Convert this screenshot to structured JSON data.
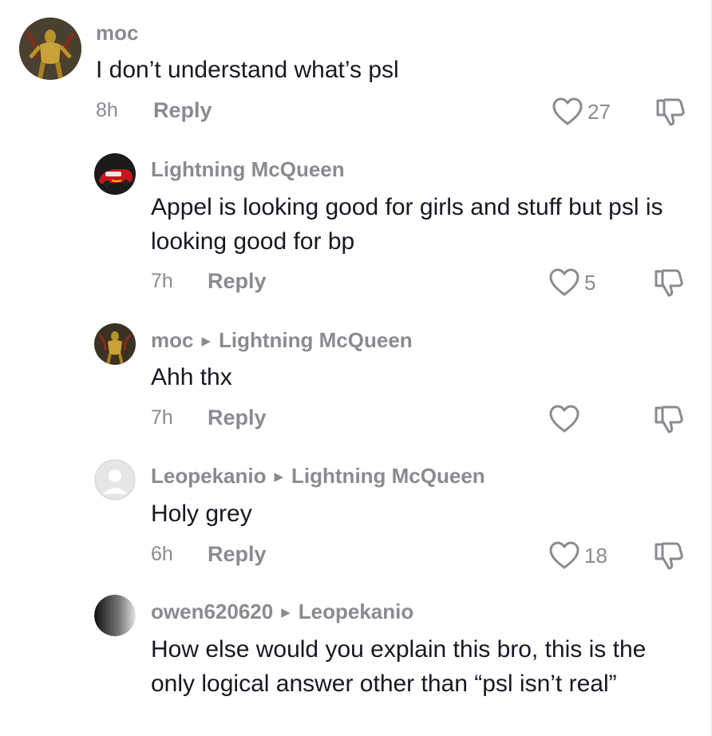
{
  "comments": [
    {
      "username": "moc",
      "reply_to": "",
      "text": "I don’t understand what’s psl",
      "time": "8h",
      "reply_label": "Reply",
      "likes": "27",
      "avatar": "warrior-avatar"
    },
    {
      "username": "Lightning McQueen",
      "reply_to": "",
      "text": "Appel is looking good for girls and stuff but psl is looking good for bp",
      "time": "7h",
      "reply_label": "Reply",
      "likes": "5",
      "avatar": "race-car-avatar"
    },
    {
      "username": "moc",
      "reply_to": "Lightning McQueen",
      "text": "Ahh thx",
      "time": "7h",
      "reply_label": "Reply",
      "likes": "",
      "avatar": "warrior-avatar"
    },
    {
      "username": "Leopekanio",
      "reply_to": "Lightning McQueen",
      "text": "Holy grey",
      "time": "6h",
      "reply_label": "Reply",
      "likes": "18",
      "avatar": "default-avatar"
    },
    {
      "username": "owen620620",
      "reply_to": "Leopekanio",
      "text": "How else would you explain this bro, this is the only logical answer other than “psl isn’t real”",
      "time": "",
      "reply_label": "",
      "likes": "",
      "avatar": "grey-gradient-avatar"
    }
  ],
  "icons": {
    "reply_arrow": "▶",
    "like": "heart-outline-icon",
    "dislike": "thumbs-down-outline-icon"
  },
  "colors": {
    "text": "#161823",
    "muted": "#8a8b91",
    "background": "#ffffff"
  }
}
